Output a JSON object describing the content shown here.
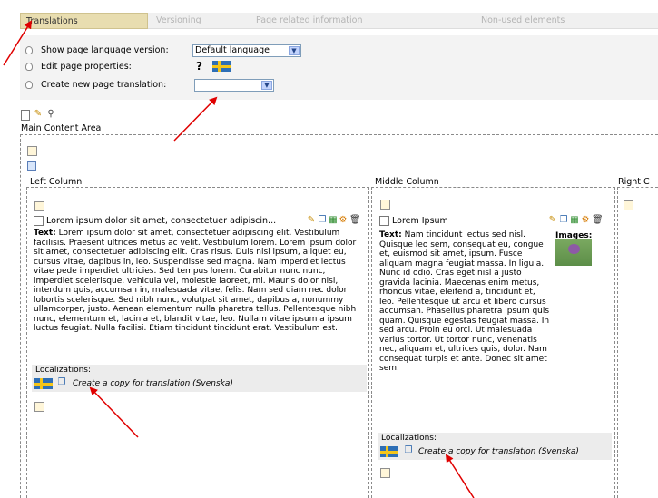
{
  "tabs": [
    {
      "label": "Translations",
      "active": true
    },
    {
      "label": "Versioning",
      "active": false
    },
    {
      "label": "Page related information",
      "active": false
    },
    {
      "label": "Non-used elements",
      "active": false
    }
  ],
  "options": {
    "show_language_label": "Show page language version:",
    "show_language_value": "Default language",
    "edit_properties_label": "Edit page properties:",
    "edit_properties_missing": "?",
    "new_translation_label": "Create new page translation:",
    "new_translation_value": ""
  },
  "main_area_title": "Main Content Area",
  "columns": {
    "left": {
      "title": "Left Column",
      "block_title": "Lorem ipsum dolor sit amet, consectetuer adipiscin...",
      "text_label": "Text:",
      "text": "Lorem ipsum dolor sit amet, consectetuer adipiscing elit. Vestibulum facilisis. Praesent ultrices metus ac velit. Vestibulum lorem. Lorem ipsum dolor sit amet, consectetuer adipiscing elit. Cras risus. Duis nisl ipsum, aliquet eu, cursus vitae, dapibus in, leo. Suspendisse sed magna. Nam imperdiet lectus vitae pede imperdiet ultricies. Sed tempus lorem. Curabitur nunc nunc, imperdiet scelerisque, vehicula vel, molestie laoreet, mi. Mauris dolor nisi, interdum quis, accumsan in, malesuada vitae, felis. Nam sed diam nec dolor lobortis scelerisque. Sed nibh nunc, volutpat sit amet, dapibus a, nonummy ullamcorper, justo. Aenean elementum nulla pharetra tellus. Pellentesque nibh nunc, elementum et, lacinia et, blandit vitae, leo. Nullam vitae ipsum a ipsum luctus feugiat. Nulla facilisi. Etiam tincidunt tincidunt erat. Vestibulum est.",
      "localizations_label": "Localizations:",
      "copy_link": "Create a copy for translation (Svenska)"
    },
    "middle": {
      "title": "Middle Column",
      "block_title": "Lorem Ipsum",
      "text_label": "Text:",
      "text": "Nam tincidunt lectus sed nisl. Quisque leo sem, consequat eu, congue et, euismod sit amet, ipsum. Fusce aliquam magna feugiat massa. In ligula. Nunc id odio. Cras eget nisl a justo gravida lacinia. Maecenas enim metus, rhoncus vitae, eleifend a, tincidunt et, leo. Pellentesque ut arcu et libero cursus accumsan. Phasellus pharetra ipsum quis quam. Quisque egestas feugiat massa. In sed arcu. Proin eu orci. Ut malesuada varius tortor. Ut tortor nunc, venenatis nec, aliquam et, ultrices quis, dolor. Nam consequat turpis et ante. Donec sit amet sem.",
      "images_label": "Images:",
      "localizations_label": "Localizations:",
      "copy_link": "Create a copy for translation (Svenska)"
    },
    "right": {
      "title": "Right C"
    }
  },
  "colors": {
    "active_tab": "#e8ddb0",
    "arrow": "#e00000",
    "flag_blue": "#2e6fb6",
    "flag_yellow": "#f4c51a"
  }
}
